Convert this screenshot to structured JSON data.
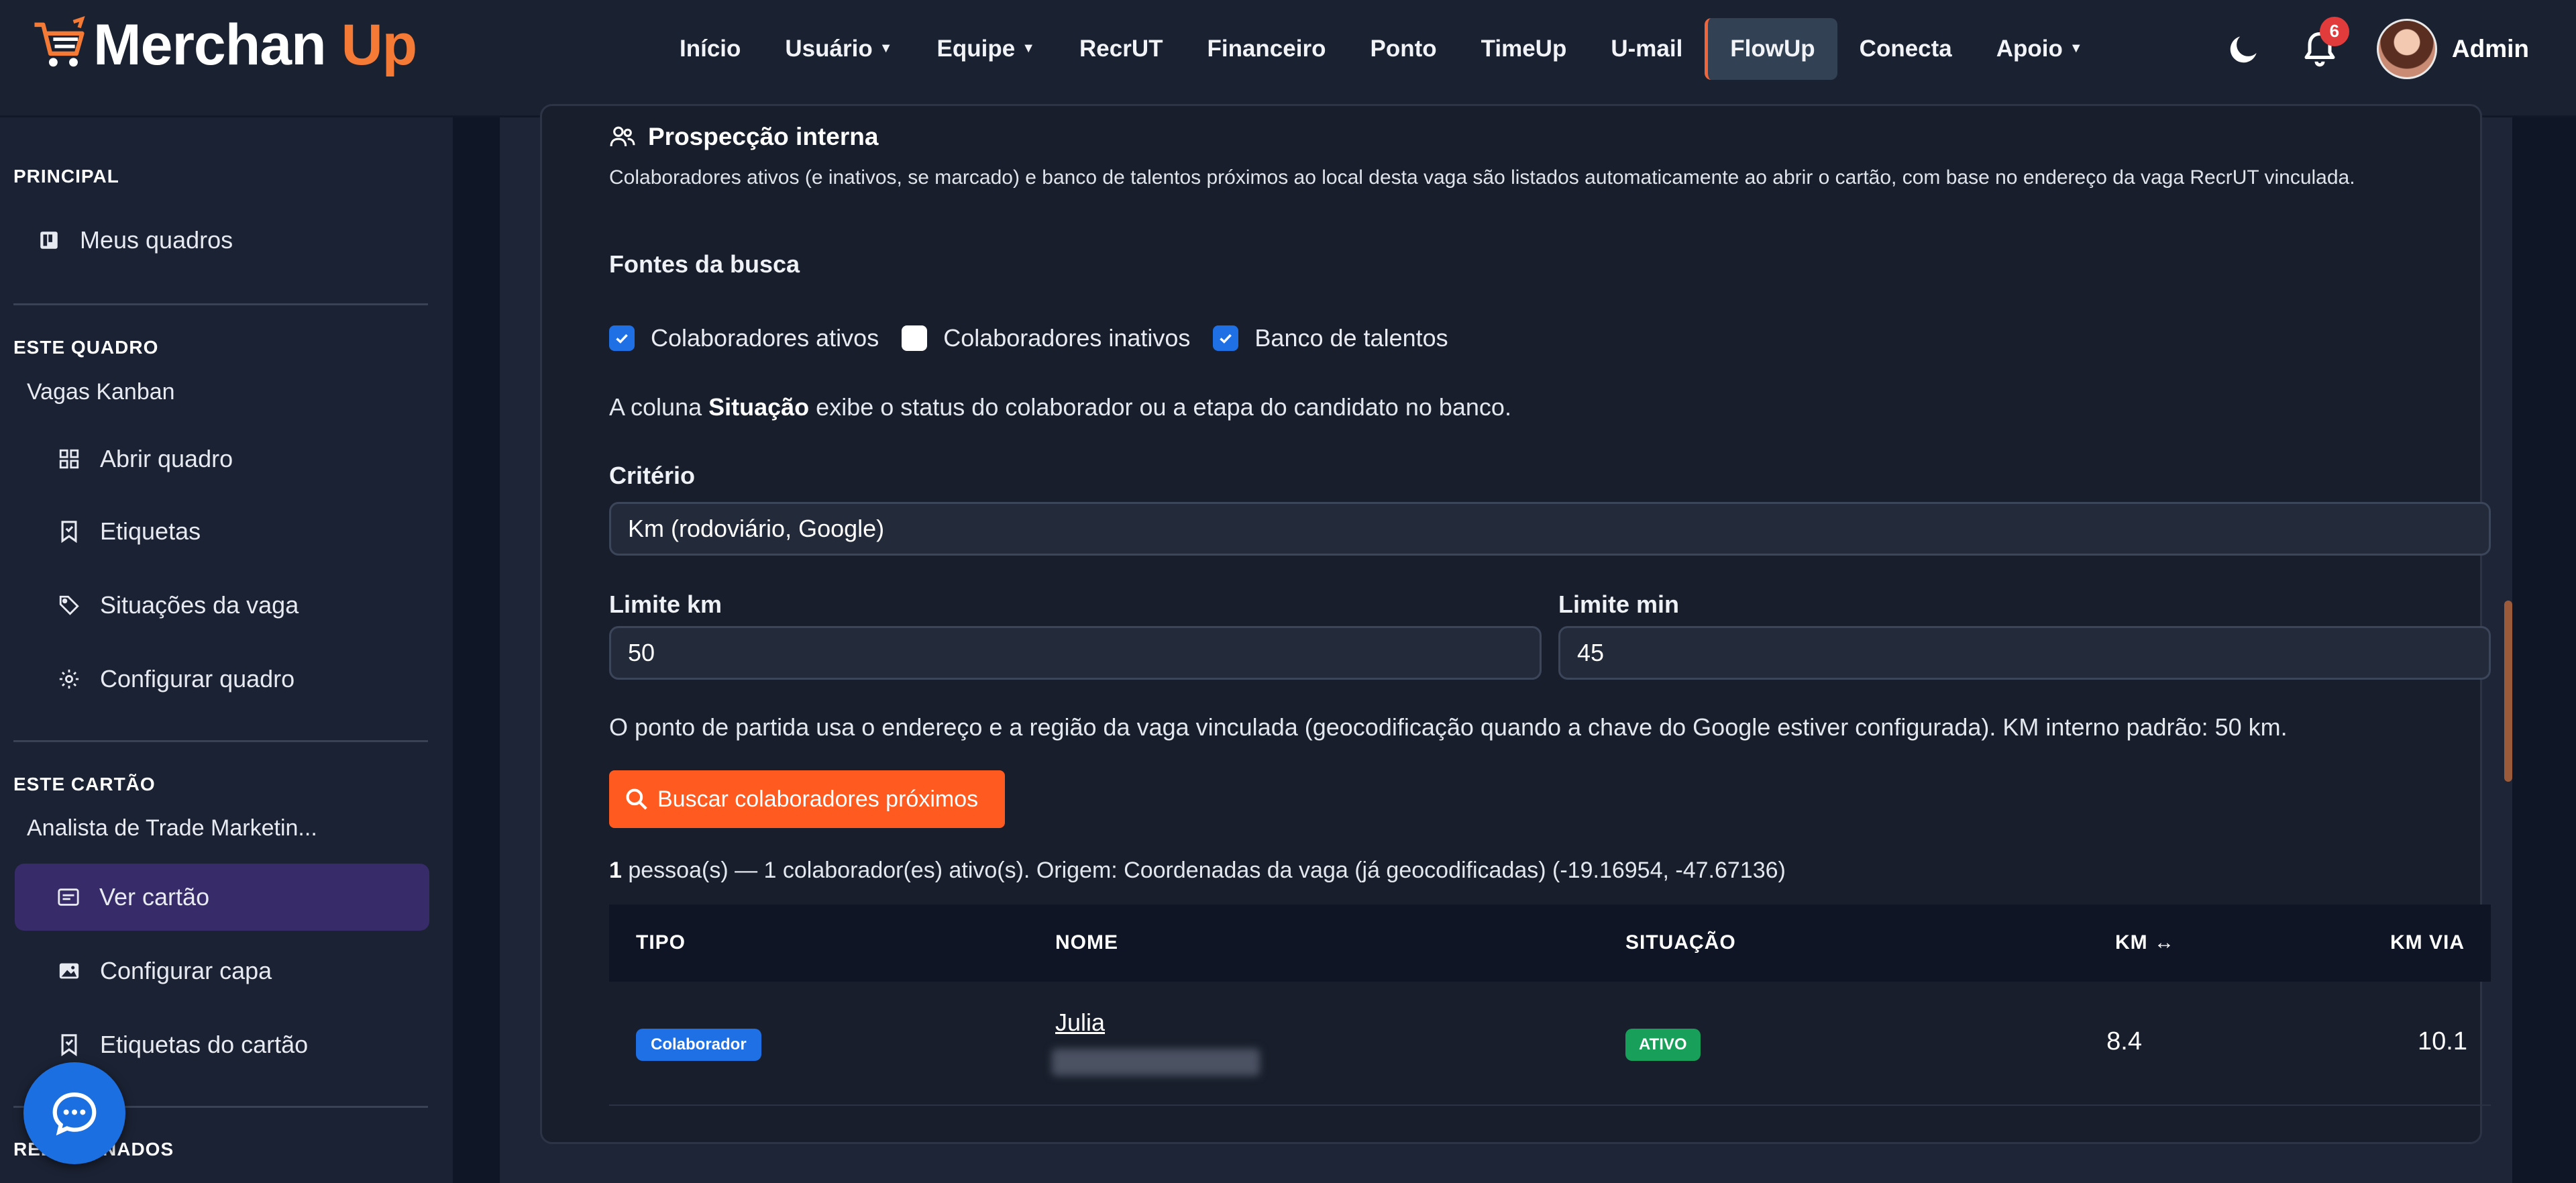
{
  "app": {
    "logo_left": "Merchan ",
    "logo_right": "Up"
  },
  "nav": {
    "items": [
      {
        "label": "Início",
        "caret": false
      },
      {
        "label": "Usuário",
        "caret": true
      },
      {
        "label": "Equipe",
        "caret": true
      },
      {
        "label": "RecrUT",
        "caret": false
      },
      {
        "label": "Financeiro",
        "caret": false
      },
      {
        "label": "Ponto",
        "caret": false
      },
      {
        "label": "TimeUp",
        "caret": false
      },
      {
        "label": "U-mail",
        "caret": false
      },
      {
        "label": "FlowUp",
        "caret": false,
        "active": true
      },
      {
        "label": "Conecta",
        "caret": false
      },
      {
        "label": "Apoio",
        "caret": true
      }
    ],
    "notifications_count": "6",
    "user_name": "Admin"
  },
  "sidebar": {
    "principal_title": "PRINCIPAL",
    "meus_quadros": "Meus quadros",
    "este_quadro_title": "ESTE QUADRO",
    "board_name": "Vagas Kanban",
    "abrir_quadro": "Abrir quadro",
    "etiquetas": "Etiquetas",
    "situacoes": "Situações da vaga",
    "configurar_quadro": "Configurar quadro",
    "este_cartao_title": "ESTE CARTÃO",
    "card_name": "Analista de Trade Marketin...",
    "ver_cartao": "Ver cartão",
    "configurar_capa": "Configurar capa",
    "etiquetas_cartao": "Etiquetas do cartão",
    "bottom_section_partial": "RELACIONADOS"
  },
  "main": {
    "section_title": "Prospecção interna",
    "description": "Colaboradores ativos (e inativos, se marcado) e banco de talentos próximos ao local desta vaga são listados automaticamente ao abrir o cartão, com base no endereço da vaga RecrUT vinculada.",
    "fontes_label": "Fontes da busca",
    "checkboxes": [
      {
        "label": "Colaboradores ativos",
        "checked": true
      },
      {
        "label": "Colaboradores inativos",
        "checked": false
      },
      {
        "label": "Banco de talentos",
        "checked": true
      }
    ],
    "situacao_note_prefix": "A coluna ",
    "situacao_note_bold": "Situação",
    "situacao_note_suffix": " exibe o status do colaborador ou a etapa do candidato no banco.",
    "criterio_label": "Critério",
    "criterio_value": "Km (rodoviário, Google)",
    "limite_km_label": "Limite km",
    "limite_km_value": "50",
    "limite_min_label": "Limite min",
    "limite_min_value": "45",
    "ponto_note": "O ponto de partida usa o endereço e a região da vaga vinculada (geocodificação quando a chave do Google estiver configurada). KM interno padrão: 50 km.",
    "search_button": "Buscar colaboradores próximos",
    "summary_count": "1",
    "summary_text": " pessoa(s) — 1 colaborador(es) ativo(s). Origem: Coordenadas da vaga (já geocodificadas) (-19.16954, -47.67136)",
    "table": {
      "headers": [
        "TIPO",
        "NOME",
        "SITUAÇÃO",
        "KM ↔",
        "KM VIA"
      ],
      "rows": [
        {
          "tipo": "Colaborador",
          "nome": "Julia",
          "situacao": "ATIVO",
          "km": "8.4",
          "km_via": "10.1"
        }
      ]
    }
  },
  "colors": {
    "accent_orange": "#ff5a1f",
    "primary_blue": "#1f6fe5",
    "success_green": "#18a05a",
    "active_sidebar": "#372b6a"
  }
}
